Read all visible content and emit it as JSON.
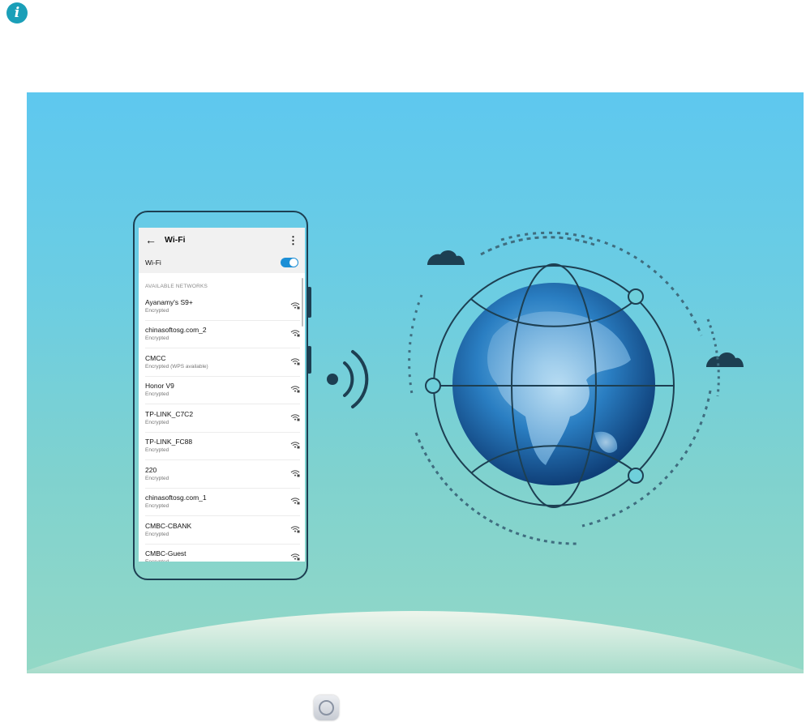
{
  "info": {
    "icon": "info-icon"
  },
  "phone": {
    "app_bar": {
      "back_icon": "arrow-left-icon",
      "title": "Wi-Fi",
      "more_icon": "more-vertical-icon"
    },
    "wifi_toggle": {
      "label": "Wi-Fi",
      "on": true
    },
    "section_header": "AVAILABLE NETWORKS",
    "networks": [
      {
        "name": "Ayanamy's S9+",
        "status": "Encrypted"
      },
      {
        "name": "chinasoftosg.com_2",
        "status": "Encrypted"
      },
      {
        "name": "CMCC",
        "status": "Encrypted (WPS available)"
      },
      {
        "name": "Honor V9",
        "status": "Encrypted"
      },
      {
        "name": "TP-LINK_C7C2",
        "status": "Encrypted"
      },
      {
        "name": "TP-LINK_FC88",
        "status": "Encrypted"
      },
      {
        "name": "220",
        "status": "Encrypted"
      },
      {
        "name": "chinasoftosg.com_1",
        "status": "Encrypted"
      },
      {
        "name": "CMBC-CBANK",
        "status": "Encrypted"
      },
      {
        "name": "CMBC-Guest",
        "status": "Encrypted"
      }
    ]
  },
  "illustration": {
    "icons": [
      "wifi-signal-icon",
      "globe-icon",
      "cloud-icon"
    ],
    "colors": {
      "sky_top": "#5ec8ef",
      "sky_bottom": "#93d8c6",
      "line": "#1d3f52",
      "toggle": "#1c8fd6"
    }
  },
  "bottom_icon": "settings-app-icon"
}
